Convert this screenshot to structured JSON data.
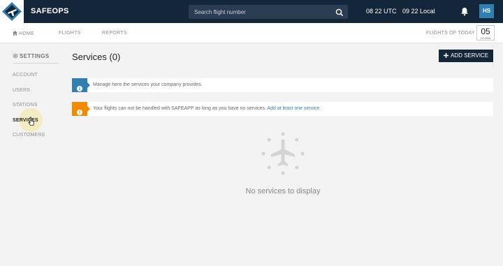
{
  "topbar": {
    "brand": "SAFEOPS",
    "search_placeholder": "Search flight number",
    "clock_utc": "08  22 UTC",
    "clock_local": "09  22 Local",
    "avatar_initials": "HS"
  },
  "navbar": {
    "home": "HOME",
    "flights": "FLIGHTS",
    "reports": "REPORTS",
    "flights_today": "FLIGHTS OF TODAY",
    "date_day": "05",
    "date_sub": "12-2016"
  },
  "sidebar": {
    "title": "SETTINGS",
    "items": [
      "ACCOUNT",
      "USERS",
      "STATIONS",
      "SERVICES",
      "CUSTOMERS"
    ]
  },
  "main": {
    "title": "Services (0)",
    "add_button": "ADD SERVICE",
    "info_alert": "Manage here the services your company provides.",
    "warning_alert": "Your flights can not be handled with SAFEAPP as long as you have no services.",
    "warning_link": "Add at least one service.",
    "empty_state": "No services to display"
  },
  "colors": {
    "topbar": "#13263a",
    "accent": "#2f7fb1",
    "warning": "#f28a00"
  },
  "icons": [
    "logo-icon",
    "search-icon",
    "bell-icon",
    "home-icon",
    "gear-icon",
    "info-icon",
    "warning-icon",
    "plane-icon",
    "cursor-icon",
    "plus-icon"
  ]
}
